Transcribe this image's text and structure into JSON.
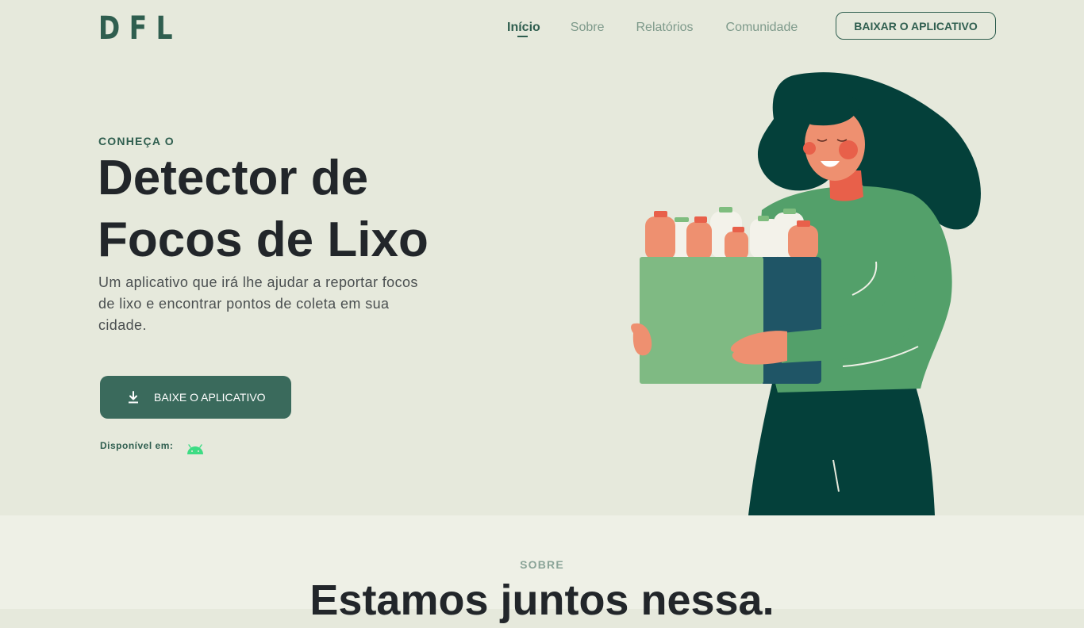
{
  "brand": {
    "logo": "DFL"
  },
  "nav": {
    "items": [
      {
        "label": "Início"
      },
      {
        "label": "Sobre"
      },
      {
        "label": "Relatórios"
      },
      {
        "label": "Comunidade"
      }
    ],
    "cta_label": "BAIXAR O APLICATIVO"
  },
  "hero": {
    "eyebrow": "CONHEÇA O",
    "title_line1": "Detector de",
    "title_line2": "Focos de Lixo",
    "description": "Um aplicativo que irá lhe ajudar a reportar focos de lixo e encontrar pontos de coleta em sua cidade.",
    "download_label": "BAIXE O APLICATIVO",
    "available_label": "Disponível em:",
    "download_icon": "download-icon",
    "platform_icon": "android-icon"
  },
  "about": {
    "eyebrow": "SOBRE",
    "title": "Estamos juntos nessa."
  },
  "colors": {
    "background": "#e6e9dc",
    "primary": "#2f5e4f",
    "button": "#3a6a5c",
    "android": "#3ddc84"
  }
}
